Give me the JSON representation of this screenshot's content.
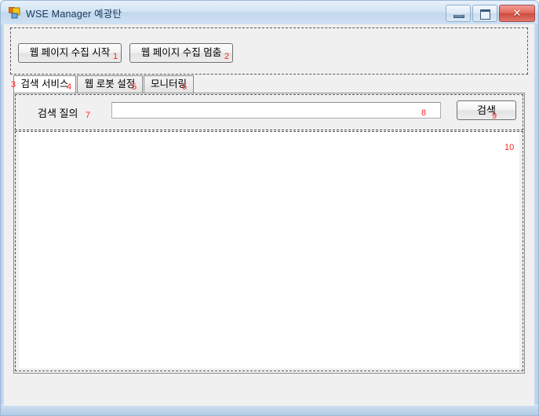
{
  "window": {
    "title": "WSE Manager 예광탄",
    "icon": "form-app-icon",
    "controls": {
      "minimize": "minimize-icon",
      "maximize": "maximize-icon",
      "close": "✕"
    }
  },
  "toolbar": {
    "start_label": "웹 페이지 수집 시작",
    "stop_label": "웹 페이지 수집 멈춤"
  },
  "tabs": [
    {
      "label": "검색 서비스",
      "selected": true
    },
    {
      "label": "웹 로봇 설정",
      "selected": false
    },
    {
      "label": "모니터링",
      "selected": false
    }
  ],
  "search_panel": {
    "query_label": "검색 질의",
    "query_value": "",
    "query_placeholder": "",
    "search_button": "검색"
  },
  "results": {
    "items": []
  },
  "annotations": [
    {
      "num": "1",
      "target": "start-crawl-button"
    },
    {
      "num": "2",
      "target": "stop-crawl-button"
    },
    {
      "num": "3",
      "target": "tab-search-service-left"
    },
    {
      "num": "4",
      "target": "tab-search-service-right"
    },
    {
      "num": "5",
      "target": "tab-robot-settings"
    },
    {
      "num": "6",
      "target": "tab-monitoring"
    },
    {
      "num": "7",
      "target": "query-label"
    },
    {
      "num": "8",
      "target": "query-input"
    },
    {
      "num": "9",
      "target": "search-button"
    },
    {
      "num": "10",
      "target": "result-list"
    }
  ],
  "colors": {
    "annotation": "#ff2222",
    "frame": "#c3d8ee",
    "client": "#f0f0f0",
    "close_button": "#cf4a3e"
  }
}
